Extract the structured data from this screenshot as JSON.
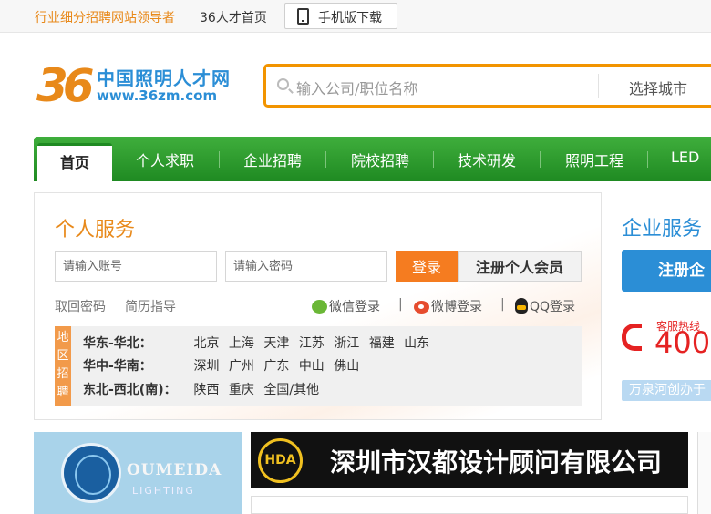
{
  "topbar": {
    "slogan": "行业细分招聘网站领导者",
    "home_link": "36人才首页",
    "mobile_download": "手机版下载"
  },
  "logo": {
    "number": "36",
    "name": "中国照明人才网",
    "url": "www.36zm.com"
  },
  "search": {
    "placeholder": "输入公司/职位名称",
    "city_label": "选择城市"
  },
  "nav": {
    "items": [
      "首页",
      "个人求职",
      "企业招聘",
      "院校招聘",
      "技术研发",
      "照明工程",
      "LED"
    ]
  },
  "personal": {
    "title": "个人服务",
    "account_placeholder": "请输入账号",
    "password_placeholder": "请输入密码",
    "login_button": "登录",
    "register_button": "注册个人会员",
    "retrieve_password": "取回密码",
    "resume_guide": "简历指导",
    "wechat_login": "微信登录",
    "weibo_login": "微博登录",
    "qq_login": "QQ登录",
    "separator": "|",
    "region_tag": [
      "地",
      "区",
      "招",
      "聘"
    ],
    "regions": [
      {
        "label": "华东-华北：",
        "cities": [
          "北京",
          "上海",
          "天津",
          "江苏",
          "浙江",
          "福建",
          "山东"
        ]
      },
      {
        "label": "华中-华南：",
        "cities": [
          "深圳",
          "广州",
          "广东",
          "中山",
          "佛山"
        ]
      },
      {
        "label": "东北-西北(南)：",
        "cities": [
          "陕西",
          "重庆",
          "全国/其他"
        ]
      }
    ]
  },
  "enterprise": {
    "title": "企业服务",
    "register_button": "注册企",
    "hotline_label": "客服热线",
    "hotline_number": "400",
    "strip_text": "万泉河创办于"
  },
  "ads": {
    "ad1_brand": "OUMEIDA",
    "ad1_sub": "LIGHTING",
    "ad2_logo": "HDA",
    "ad2_name": "深圳市汉都设计顾问有限公司"
  }
}
